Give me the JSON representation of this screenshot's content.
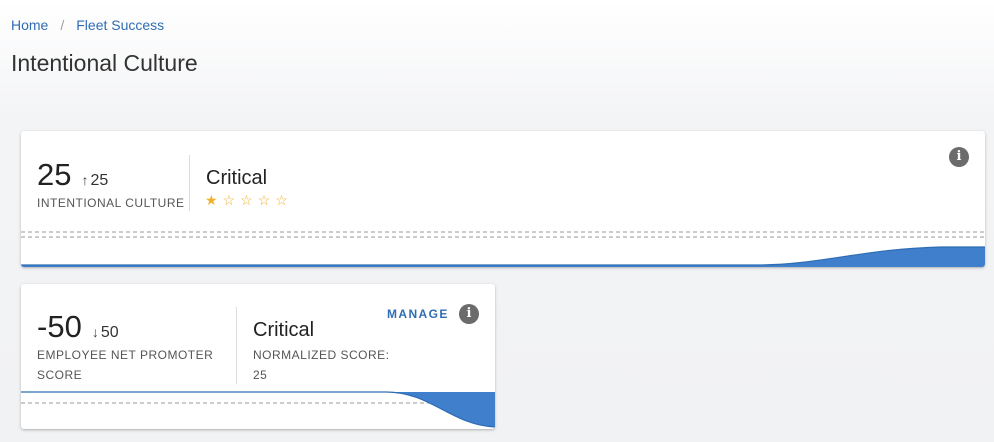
{
  "breadcrumb": {
    "home": "Home",
    "separator": "/",
    "current": "Fleet Success"
  },
  "page": {
    "title": "Intentional Culture"
  },
  "cards": [
    {
      "score": "25",
      "delta_arrow": "↑",
      "delta": "25",
      "label": "INTENTIONAL CULTURE",
      "status": "Critical",
      "stars": {
        "filled": 1,
        "total": 5
      },
      "info_icon": "info-icon"
    },
    {
      "score": "-50",
      "delta_arrow": "↓",
      "delta": "50",
      "label_line1": "EMPLOYEE NET PROMOTER",
      "label_line2": "SCORE",
      "status": "Critical",
      "normalized_label": "NORMALIZED SCORE:",
      "normalized_value": "25",
      "manage_label": "MANAGE",
      "info_icon": "info-icon"
    }
  ],
  "colors": {
    "accent": "#2f6db3",
    "area_fill": "#3f7fcc",
    "star": "#f2b12a"
  }
}
